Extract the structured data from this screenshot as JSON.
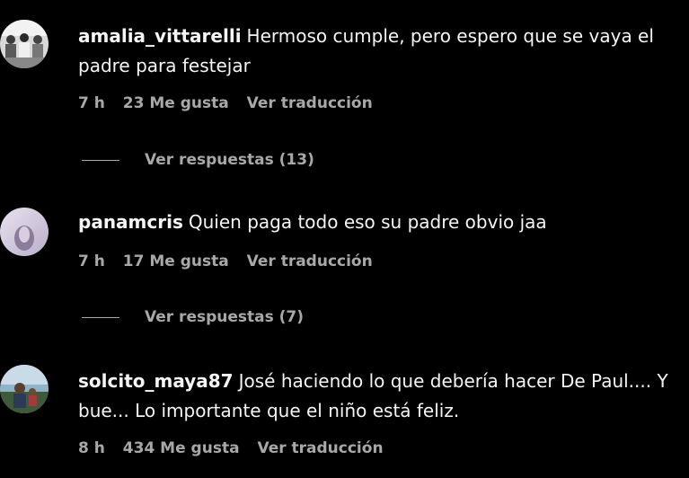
{
  "comments": [
    {
      "username": "amalia_vittarelli",
      "text": "Hermoso cumple, pero espero que se vaya el padre para festejar",
      "time": "7 h",
      "likes": "23 Me gusta",
      "translate": "Ver traducción",
      "replies": "Ver respuestas (13)",
      "avatar_icon": "profile-photo"
    },
    {
      "username": "panamcris",
      "text": "Quien paga todo eso su padre obvio jaa",
      "time": "7 h",
      "likes": "17 Me gusta",
      "translate": "Ver traducción",
      "replies": "Ver respuestas (7)",
      "avatar_icon": "profile-photo"
    },
    {
      "username": "solcito_maya87",
      "text": "José haciendo lo que debería hacer De Paul.... Y bue... Lo importante que el niño está feliz.",
      "time": "8 h",
      "likes": "434 Me gusta",
      "translate": "Ver traducción",
      "avatar_icon": "profile-photo"
    }
  ],
  "colors": {
    "background": "#000000",
    "text": "#f5f5f5",
    "secondary": "#a8a8a8"
  }
}
